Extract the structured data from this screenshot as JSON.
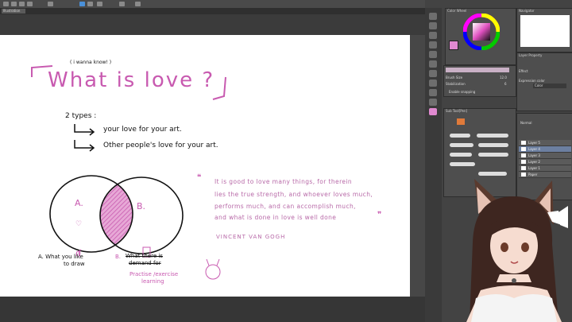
{
  "window": {
    "tab_label": "Illustration"
  },
  "canvas": {
    "subtitle": "( i wanna know! )",
    "title": "What is love ?",
    "types_heading": "2 types :",
    "type1": "your love for your art.",
    "type2": "Other people's love for your art.",
    "venn_a": "A.",
    "venn_b": "B.",
    "label_a_line1": "A. What you like",
    "label_a_line2": "to draw",
    "label_b_prefix": "B.",
    "label_b_line1": "What there is",
    "label_b_line2": "demand for",
    "overlap_line1": "Practise /exercise",
    "overlap_line2": "learning",
    "quote_lines": [
      "It is good to love many things, for therein",
      "lies the true strength, and whoever loves much,",
      "performs much, and can accomplish much,",
      "and what is done in love is well done"
    ],
    "quote_author": "VINCENT VAN GOGH"
  },
  "panels": {
    "color_wheel_title": "Color Wheel",
    "navigator_title": "Navigator",
    "brush_size_label": "Brush Size",
    "brush_size_value": "12.0",
    "stabilization_label": "Stabilization",
    "stabilization_value": "6",
    "snapping_label": "Enable snapping",
    "layer_property_title": "Layer Property",
    "effect_label": "Effect",
    "expression_color_label": "Expression color",
    "expression_color_value": "Color",
    "sub_tool_title": "Sub Tool[Pen]",
    "layer_blend": "Normal",
    "layers": [
      {
        "pct": "100 %",
        "mode": "Normal",
        "name": "Layer 5"
      },
      {
        "pct": "100 %",
        "mode": "Normal",
        "name": "Layer 4"
      },
      {
        "pct": "100 %",
        "mode": "Normal",
        "name": "Layer 3"
      },
      {
        "pct": "100 %",
        "mode": "Normal",
        "name": "Layer 2"
      },
      {
        "pct": "100 %",
        "mode": "Normal",
        "name": "Layer 1"
      },
      {
        "pct": "",
        "mode": "",
        "name": "Paper"
      }
    ]
  },
  "colors": {
    "accent_pink": "#c85ab0",
    "quote_pink": "#b86aa8"
  }
}
